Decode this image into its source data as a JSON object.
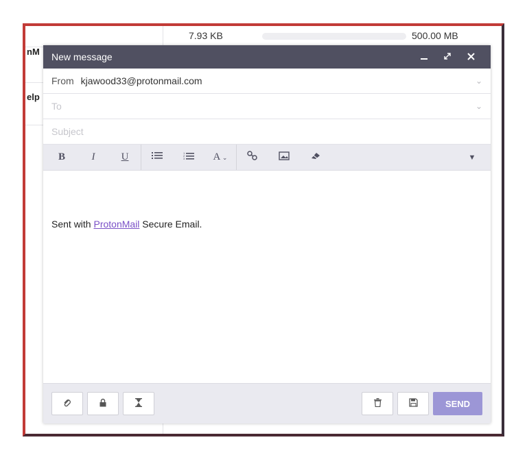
{
  "background": {
    "left_stub_1": "nM",
    "left_stub_2": "elp",
    "storage_used": "7.93 KB",
    "storage_max": "500.00 MB"
  },
  "composer": {
    "title": "New message",
    "from_label": "From",
    "from_value": "kjawood33@protonmail.com",
    "to_placeholder": "To",
    "subject_placeholder": "Subject",
    "signature_prefix": "Sent with ",
    "signature_link": "ProtonMail",
    "signature_suffix": " Secure Email.",
    "send_label": "SEND"
  },
  "icons": {
    "minimize": "minimize-icon",
    "expand": "expand-icon",
    "close": "close-icon",
    "bold": "bold-icon",
    "italic": "italic-icon",
    "underline": "underline-icon",
    "bullet_list": "bullet-list-icon",
    "numbered_list": "numbered-list-icon",
    "font": "font-icon",
    "link": "link-icon",
    "image": "image-icon",
    "eraser": "eraser-icon",
    "more": "caret-down-icon",
    "attach": "paperclip-icon",
    "encrypt": "lock-icon",
    "expire": "hourglass-icon",
    "delete": "trash-icon",
    "save": "floppy-disk-icon"
  },
  "colors": {
    "titlebar": "#505061",
    "link": "#7a50c7",
    "send_button": "#9c96d6",
    "frame_border": "#c23b37"
  }
}
